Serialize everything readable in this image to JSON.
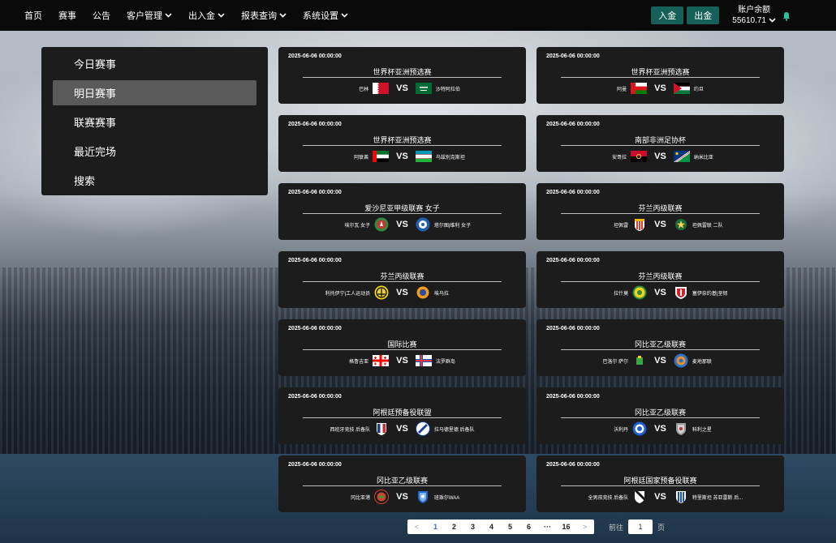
{
  "nav": {
    "items": [
      {
        "label": "首页",
        "dropdown": false
      },
      {
        "label": "赛事",
        "dropdown": false
      },
      {
        "label": "公告",
        "dropdown": false
      },
      {
        "label": "客户管理",
        "dropdown": true
      },
      {
        "label": "出入金",
        "dropdown": true
      },
      {
        "label": "报表查询",
        "dropdown": true
      },
      {
        "label": "系统设置",
        "dropdown": true
      }
    ],
    "deposit_label": "入金",
    "withdraw_label": "出金",
    "balance_label": "账户余额",
    "balance_value": "55610.71"
  },
  "sidebar": {
    "items": [
      {
        "label": "今日赛事",
        "active": false
      },
      {
        "label": "明日赛事",
        "active": true
      },
      {
        "label": "联赛赛事",
        "active": false
      },
      {
        "label": "最近完场",
        "active": false
      },
      {
        "label": "搜索",
        "active": false
      }
    ]
  },
  "matches": [
    {
      "time": "2025-06-06 00:00:00",
      "league": "世界杯亚洲预选赛",
      "home": "巴林",
      "away": "沙特阿拉伯",
      "home_logo": "flag-bahrain",
      "away_logo": "flag-saudi-arabia"
    },
    {
      "time": "2025-06-06 00:00:00",
      "league": "世界杯亚洲预选赛",
      "home": "阿曼",
      "away": "约旦",
      "home_logo": "flag-oman",
      "away_logo": "flag-jordan"
    },
    {
      "time": "2025-06-06 00:00:00",
      "league": "世界杯亚洲预选赛",
      "home": "阿联酋",
      "away": "乌兹别克斯坦",
      "home_logo": "flag-uae",
      "away_logo": "flag-uzbekistan"
    },
    {
      "time": "2025-06-06 00:00:00",
      "league": "南部非洲足协杯",
      "home": "安哥拉",
      "away": "纳米比亚",
      "home_logo": "flag-angola",
      "away_logo": "flag-namibia"
    },
    {
      "time": "2025-06-06 00:00:00",
      "league": "爱沙尼亚甲级联赛 女子",
      "home": "埃尔瓦 女子",
      "away": "塔尔图|维利 女子",
      "home_logo": "club-crest-green",
      "away_logo": "club-crest-blue-ball"
    },
    {
      "time": "2025-06-06 00:00:00",
      "league": "芬兰丙级联赛",
      "home": "坦佩雷",
      "away": "坦佩雷联 二队",
      "home_logo": "club-crest-red-stripes",
      "away_logo": "club-crest-green-star"
    },
    {
      "time": "2025-06-06 00:00:00",
      "league": "芬兰丙级联赛",
      "home": "利托伊宁|工人运动员",
      "away": "埃乌拉",
      "home_logo": "club-crest-yellow-black",
      "away_logo": "club-crest-orange"
    },
    {
      "time": "2025-06-06 00:00:00",
      "league": "芬兰丙级联赛",
      "home": "拉什莫",
      "away": "塞伊奈约基|坚韧",
      "home_logo": "club-crest-yellow-green",
      "away_logo": "club-crest-red-shield"
    },
    {
      "time": "2025-06-06 00:00:00",
      "league": "国际比赛",
      "home": "格鲁吉亚",
      "away": "法罗群岛",
      "home_logo": "flag-georgia",
      "away_logo": "flag-faroe-islands"
    },
    {
      "time": "2025-06-06 00:00:00",
      "league": "冈比亚乙级联赛",
      "home": "巴洛尔 萨尔",
      "away": "麦地那联",
      "home_logo": "club-crest-green-small",
      "away_logo": "club-crest-blue-orange"
    },
    {
      "time": "2025-06-06 00:00:00",
      "league": "阿根廷预备役联盟",
      "home": "西班牙竞技 后备队",
      "away": "拉马德里德 后备队",
      "home_logo": "club-crest-blue-white-red",
      "away_logo": "club-crest-blue-white-stripes"
    },
    {
      "time": "2025-06-06 00:00:00",
      "league": "冈比亚乙级联赛",
      "home": "沃利丹",
      "away": "科利之星",
      "home_logo": "club-crest-blue-round",
      "away_logo": "club-crest-grey-shield"
    },
    {
      "time": "2025-06-06 00:00:00",
      "league": "冈比亚乙级联赛",
      "home": "冈比亚港",
      "away": "班珠尔WAA",
      "home_logo": "club-crest-red-green",
      "away_logo": "club-crest-blue-shield"
    },
    {
      "time": "2025-06-06 00:00:00",
      "league": "阿根廷国家预备役联赛",
      "home": "全男孩竞技 后备队",
      "away": "特里斯坦 苏亚雷斯 后...",
      "home_logo": "club-crest-black-white",
      "away_logo": "club-crest-blue-white-vertical"
    }
  ],
  "pagination": {
    "prev": "<",
    "next": ">",
    "pages": [
      "1",
      "2",
      "3",
      "4",
      "5",
      "6",
      "···",
      "16"
    ],
    "current": "1",
    "goto_label": "前往",
    "goto_value": "1",
    "page_unit": "页"
  },
  "colors": {
    "nav_bg": "#0a0a0a",
    "button_teal": "#16605a",
    "card_bg": "#1c1c1c",
    "sidebar_active": "#5a5a5a",
    "page_active": "#2a6ef0"
  }
}
